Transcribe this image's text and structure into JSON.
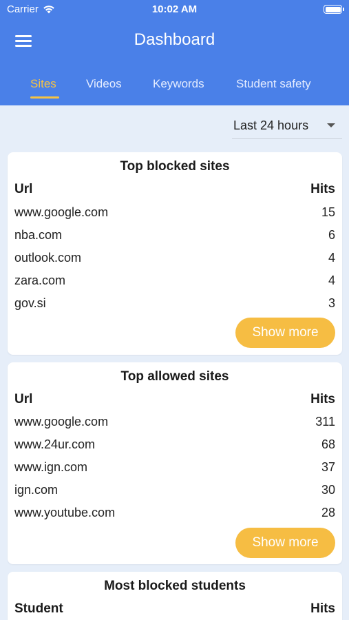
{
  "status_bar": {
    "carrier": "Carrier",
    "time": "10:02 AM"
  },
  "header": {
    "title": "Dashboard",
    "menu_icon": "hamburger-menu-icon"
  },
  "tabs": [
    {
      "label": "Sites",
      "active": true
    },
    {
      "label": "Videos",
      "active": false
    },
    {
      "label": "Keywords",
      "active": false
    },
    {
      "label": "Student safety",
      "active": false
    }
  ],
  "filter": {
    "selected": "Last 24 hours"
  },
  "colors": {
    "header": "#4a80e8",
    "accent": "#f6c343",
    "button": "#f6bd43",
    "background": "#e6eef9"
  },
  "top_blocked": {
    "title": "Top blocked sites",
    "col_url": "Url",
    "col_hits": "Hits",
    "rows": [
      {
        "url": "www.google.com",
        "hits": "15"
      },
      {
        "url": "nba.com",
        "hits": "6"
      },
      {
        "url": "outlook.com",
        "hits": "4"
      },
      {
        "url": "zara.com",
        "hits": "4"
      },
      {
        "url": "gov.si",
        "hits": "3"
      }
    ],
    "button": "Show more"
  },
  "top_allowed": {
    "title": "Top allowed sites",
    "col_url": "Url",
    "col_hits": "Hits",
    "rows": [
      {
        "url": "www.google.com",
        "hits": "311"
      },
      {
        "url": "www.24ur.com",
        "hits": "68"
      },
      {
        "url": "www.ign.com",
        "hits": "37"
      },
      {
        "url": "ign.com",
        "hits": "30"
      },
      {
        "url": "www.youtube.com",
        "hits": "28"
      }
    ],
    "button": "Show more"
  },
  "most_blocked_students": {
    "title": "Most blocked students",
    "col_student": "Student",
    "col_hits": "Hits"
  }
}
